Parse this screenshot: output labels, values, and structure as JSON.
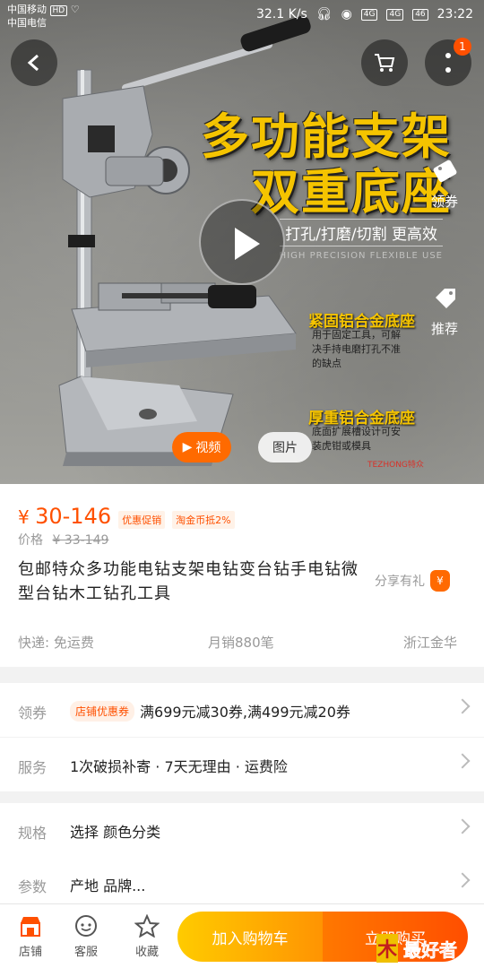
{
  "status_bar": {
    "carrier_1": "中国移动",
    "carrier_1_badge": "HD",
    "carrier_2": "中国电信",
    "speed": "32.1 K/s",
    "net_1": "4G",
    "net_2": "4G",
    "battery": "46",
    "time": "23:22"
  },
  "hero": {
    "cart_badge": "1",
    "headline_1": "多功能支架",
    "headline_2": "双重底座",
    "subline": "打孔/打磨/切割 更高效",
    "subline_en": "HIGH PRECISION FLEXIBLE USE",
    "feature_1_title": "紧固铝合金底座",
    "feature_1_text": [
      "用于固定工具，可解",
      "决手持电磨打孔不准",
      "的缺点"
    ],
    "feature_2_title": "厚重铝合金底座",
    "feature_2_text": [
      "底面扩展槽设计可安",
      "装虎钳或模具"
    ],
    "brand_mark": "TEZHONG特众",
    "side_coupon_label": "领券",
    "side_recommend_label": "推荐",
    "video_pill": "视频",
    "photo_pill": "图片"
  },
  "product": {
    "price_currency": "¥",
    "price_range": "30-146",
    "tag_promo": "优惠促销",
    "tag_coin": "淘金币抵2%",
    "orig_label": "价格",
    "orig_price": "¥ 33-149",
    "title": "包邮特众多功能电钻支架电钻变台钻手电钻微型台钻木工钻孔工具",
    "share_label": "分享有礼",
    "share_icon_char": "¥",
    "shipping": "快递: 免运费",
    "monthly_sales": "月销880笔",
    "location": "浙江金华"
  },
  "rows": {
    "coupon_label": "领券",
    "coupon_tag": "店铺优惠券",
    "coupon_value": "满699元减30券,满499元减20券",
    "service_label": "服务",
    "service_value": "1次破损补寄 · 7天无理由 · 运费险",
    "spec_label": "规格",
    "spec_value": "选择 颜色分类",
    "param_label": "参数",
    "param_value": "产地 品牌..."
  },
  "bottom_bar": {
    "shop_label": "店铺",
    "service_label": "客服",
    "fav_label": "收藏",
    "add_cart": "加入购物车",
    "buy_now": "立即购买"
  },
  "watermark": {
    "text": "最好者"
  },
  "colors": {
    "accent": "#ff5000",
    "headline_yellow": "#f5c400",
    "cart_gradient_start": "#ffcb00",
    "buy_gradient_end": "#ff4e00"
  }
}
